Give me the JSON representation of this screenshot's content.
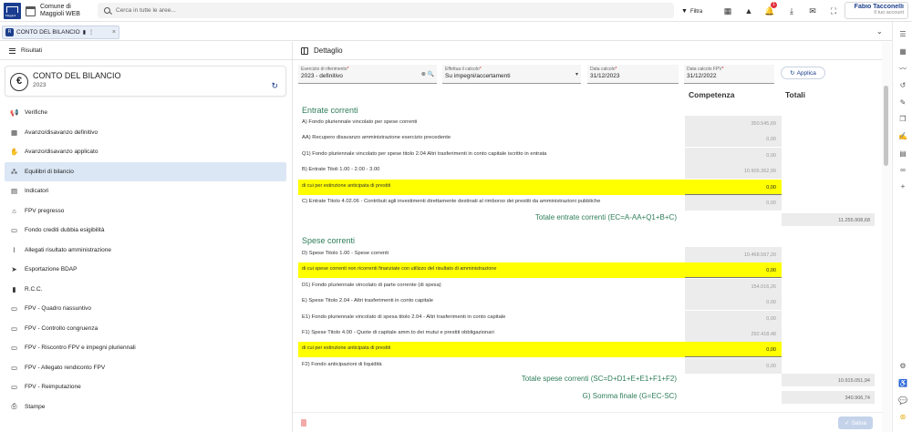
{
  "app": {
    "brand_line1": "Comune di",
    "brand_line2": "Maggioli WEB",
    "logo_text": "Maggioli",
    "search_placeholder": "Cerca in tutte le aree...",
    "filter_label": "Filtra",
    "notification_count": "1",
    "user_name": "Fabio Tacconelli",
    "user_subtitle": "Il tuo account"
  },
  "tab": {
    "label": "CONTO DEL BILANCIO",
    "icon_text": "R"
  },
  "left": {
    "header": "Risultati",
    "card_title": "CONTO DEL BILANCIO",
    "card_year": "2023",
    "menu": [
      {
        "label": "Verifiche",
        "icon": "megaphone-icon",
        "glyph": "📢",
        "active": false
      },
      {
        "label": "Avanzo/disavanzo definitivo",
        "icon": "calculator-icon",
        "glyph": "▦",
        "active": false
      },
      {
        "label": "Avanzo/disavanzo applicato",
        "icon": "money-hand-icon",
        "glyph": "✋",
        "active": false
      },
      {
        "label": "Equilibri di bilancio",
        "icon": "sitemap-icon",
        "glyph": "⁂",
        "active": true
      },
      {
        "label": "Indicatori",
        "icon": "document-chart-icon",
        "glyph": "▤",
        "active": false
      },
      {
        "label": "FPV pregresso",
        "icon": "bank-icon",
        "glyph": "⌂",
        "active": false
      },
      {
        "label": "Fondo crediti dubbia esigibilità",
        "icon": "money-bill-icon",
        "glyph": "▭",
        "active": false
      },
      {
        "label": "Allegati risultato amministrazione",
        "icon": "paperclip-icon",
        "glyph": "⌇",
        "active": false
      },
      {
        "label": "Esportazione BDAP",
        "icon": "send-icon",
        "glyph": "➤",
        "active": false
      },
      {
        "label": "R.C.C.",
        "icon": "file-icon",
        "glyph": "▮",
        "active": false
      },
      {
        "label": "FPV - Quadro riassuntivo",
        "icon": "credit-card-icon",
        "glyph": "▭",
        "active": false
      },
      {
        "label": "FPV - Controllo congruenza",
        "icon": "credit-card-icon",
        "glyph": "▭",
        "active": false
      },
      {
        "label": "FPV - Riscontro FPV e impegni pluriennali",
        "icon": "credit-card-icon",
        "glyph": "▭",
        "active": false
      },
      {
        "label": "FPV - Allegato rendiconto FPV",
        "icon": "credit-card-icon",
        "glyph": "▭",
        "active": false
      },
      {
        "label": "FPV - Reimputazione",
        "icon": "credit-card-icon",
        "glyph": "▭",
        "active": false
      },
      {
        "label": "Stampe",
        "icon": "printer-icon",
        "glyph": "⎙",
        "active": false
      }
    ]
  },
  "right": {
    "header": "Dettaglio",
    "filters": {
      "esercizio_label": "Esercizio di riferimento",
      "esercizio_value": "2023 - definitivo",
      "effettua_label": "Effettua il calcolo",
      "effettua_value": "Su impegni/accertamenti",
      "data_calcolo_label": "Data calcolo",
      "data_calcolo_value": "31/12/2023",
      "data_fpv_label": "Data calcolo FPV",
      "data_fpv_value": "31/12/2022",
      "required_mark": "*"
    },
    "applica_label": "Applica",
    "col_competenza": "Competenza",
    "col_totali": "Totali",
    "entrate_title": "Entrate correnti",
    "entrate_rows": [
      {
        "label": "A) Fondo pluriennale vincolato per spese correnti",
        "value": "350.545,69",
        "hl": false
      },
      {
        "label": "AA) Recupero disavanzo amministrazione esercizio precedente",
        "value": "0,00",
        "hl": false
      },
      {
        "label": "Q1) Fondo pluriennale vincolato per spese titolo 2.04 Altri trasferimenti in conto capitale iscritto in entrata",
        "value": "0,00",
        "hl": false
      },
      {
        "label": "B) Entrate Titoli 1.00 - 2.00 - 3.00",
        "value": "10.905.362,99",
        "hl": false
      },
      {
        "label": "di cui per estinzione anticipata di prestiti",
        "value": "0,00",
        "hl": true
      },
      {
        "label": "C) Entrate Titolo 4.02.06 - Contributi agli investimenti direttamente destinati al rimborso dei prestiti da amministrazioni pubbliche",
        "value": "0,00",
        "hl": false
      }
    ],
    "totale_entrate_label": "Totale entrate correnti (EC=A-AA+Q1+B+C)",
    "totale_entrate_value": "11.255.908,68",
    "spese_title": "Spese correnti",
    "spese_rows": [
      {
        "label": "D) Spese Titolo 1.00 - Spese correnti",
        "value": "10.468.567,20",
        "hl": false
      },
      {
        "label": "di cui spese correnti non ricorrenti finanziate con utilizzo del risultato di amministrazione",
        "value": "0,00",
        "hl": true
      },
      {
        "label": "D1) Fondo pluriennale vincolato di parte corrente (di spesa)",
        "value": "154.016,26",
        "hl": false
      },
      {
        "label": "E) Spese Titolo 2.04 - Altri trasferimenti in conto capitale",
        "value": "0,00",
        "hl": false
      },
      {
        "label": "E1) Fondo pluriennale vincolato di spesa titolo 2.04 - Altri trasferimenti in conto capitale",
        "value": "0,00",
        "hl": false
      },
      {
        "label": "F1) Spese Titolo 4.00 - Quote di capitale amm.to dei mutui e prestiti obbligazionari",
        "value": "292.418,48",
        "hl": false
      },
      {
        "label": "di cui per estinzione anticipata di prestiti",
        "value": "0,00",
        "hl": true
      },
      {
        "label": "F2) Fondo anticipazioni di liquidità",
        "value": "0,00",
        "hl": false
      }
    ],
    "totale_spese_label": "Totale spese correnti (SC=D+D1+E+E1+F1+F2)",
    "totale_spese_value": "10.915.051,94",
    "somma_label": "G) Somma finale (G=EC-SC)",
    "somma_value": "340.906,74",
    "salva_label": "Salva"
  },
  "colors": {
    "primary": "#1c3f8c",
    "section_green": "#2e7d5a",
    "highlight": "#ffff00",
    "active_menu": "#dbe7f5"
  }
}
